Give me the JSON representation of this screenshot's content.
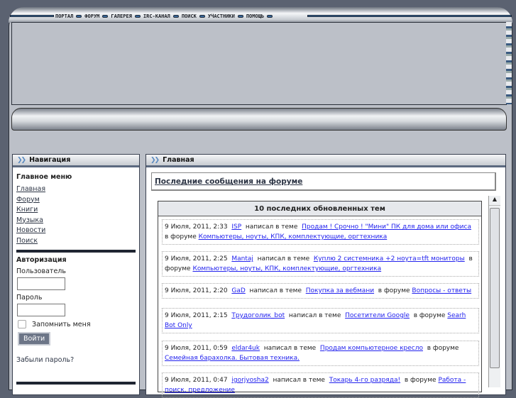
{
  "top_nav": [
    "ПОРТАЛ",
    "ФОРУМ",
    "ГАЛЕРЕЯ",
    "IRC-КАНАЛ",
    "ПОИСК",
    "УЧАСТНИКИ",
    "ПОМОЩЬ"
  ],
  "nav_panel": {
    "title": "Навигация",
    "menu_heading": "Главное меню",
    "links": [
      "Главная",
      "Форум",
      "Книги",
      "Музыка",
      "Новости",
      "Поиск"
    ],
    "auth_heading": "Авторизация",
    "user_label": "Пользователь",
    "pass_label": "Пароль",
    "remember": "Запомнить меня",
    "login": "Войти",
    "forgot": "Забыли пароль?"
  },
  "main": {
    "title": "Главная",
    "subtitle": "Последние сообщения на форуме",
    "box_title": "10 последних обновленных тем",
    "wrote": "написал в теме",
    "in_forum": "в форуме",
    "posts": [
      {
        "date": "9 Июля, 2011, 2:33",
        "user": "ISP",
        "topic": "Продам ! Срочно ! \"Мини\" ПК для дома или офиса",
        "forum": "Компьютеры, ноуты, КПК, комплектующие, оргтехника"
      },
      {
        "date": "9 Июля, 2011, 2:25",
        "user": "Mantaj",
        "topic": "Куплю 2 системника +2 ноута=tft мониторы",
        "forum": "Компьютеры, ноуты, КПК, комплектующие, оргтехника"
      },
      {
        "date": "9 Июля, 2011, 2:20",
        "user": "GaD",
        "topic": "Покупка за вебмани",
        "forum": "Вопросы - ответы"
      },
      {
        "date": "9 Июля, 2011, 2:15",
        "user": "Трудоголик_bot",
        "topic": "Посетители Google",
        "forum": "Searh Bot Only"
      },
      {
        "date": "9 Июля, 2011, 0:59",
        "user": "eldar4uk",
        "topic": "Продам компьютерное кресло",
        "forum": "Семейная барахолка. Бытовая техника."
      },
      {
        "date": "9 Июля, 2011, 0:47",
        "user": "igorjyosha2",
        "topic": "Токарь 4-го разряда!",
        "forum": "Работа - поиск, предложение"
      }
    ]
  }
}
